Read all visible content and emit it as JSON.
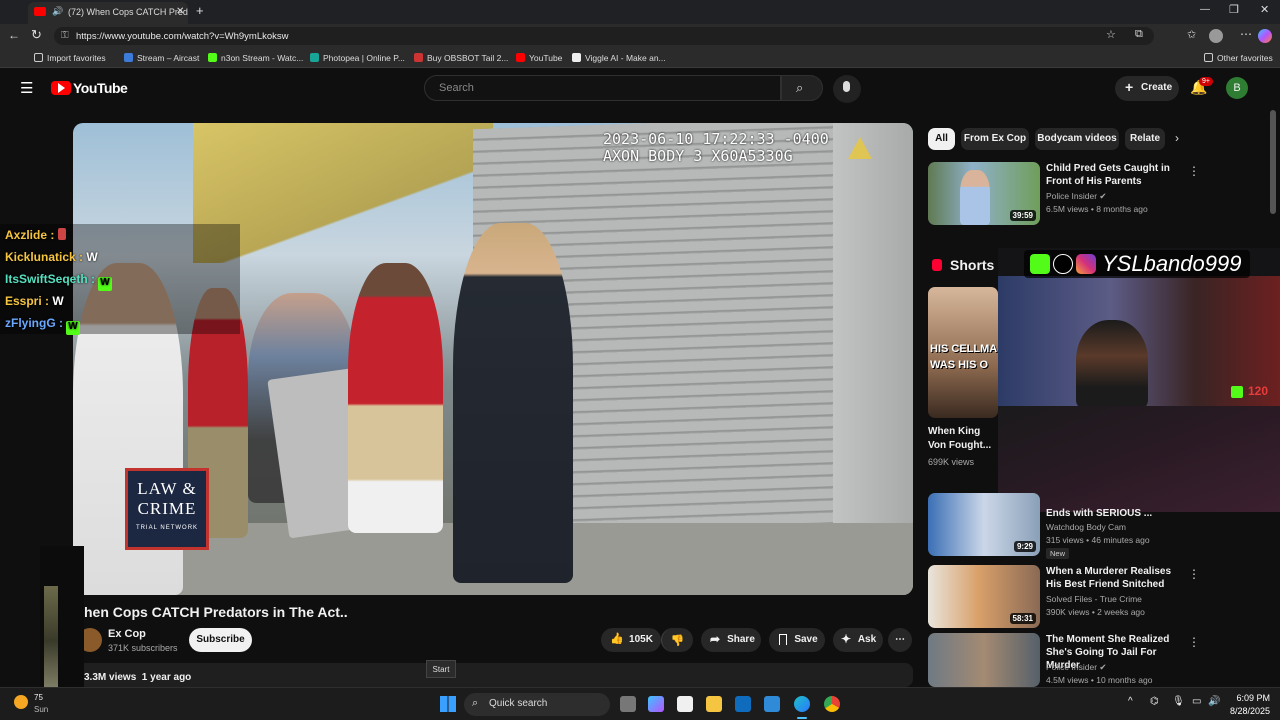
{
  "browser": {
    "tab_title": "(72) When Cops CATCH Predators...",
    "url": "https://www.youtube.com/watch?v=Wh9ymLkoksw",
    "bookmarks": [
      "Import favorites",
      "Stream – Aircast",
      "n3on Stream - Watc...",
      "Photopea | Online P...",
      "Buy OBSBOT Tail 2...",
      "YouTube",
      "Viggle AI - Make an..."
    ],
    "other_favorites": "Other favorites"
  },
  "youtube": {
    "logo": "YouTube",
    "search_placeholder": "Search",
    "create_label": "Create",
    "notif_count": "9+",
    "avatar_letter": "B"
  },
  "video": {
    "timestamp": "2023-06-10 17:22:33 -0400",
    "camera": "AXON BODY 3 X60A5330G",
    "watermark_line1": "LAW & CRIME",
    "watermark_line2": "TRIAL NETWORK",
    "title": "hen Cops CATCH Predators in The Act..",
    "channel": "Ex Cop",
    "subscribers": "371K subscribers",
    "subscribe_label": "Subscribe",
    "likes": "105K",
    "share_label": "Share",
    "save_label": "Save",
    "ask_label": "Ask",
    "views_line": "3.3M views  1 year ago",
    "start_tooltip": "Start"
  },
  "chat": [
    {
      "user": "Axzlide :",
      "msg": ""
    },
    {
      "user": "Kicklunatick :",
      "msg": "W"
    },
    {
      "user": "ItsSwiftSeqeth :",
      "msg": ""
    },
    {
      "user": "Esspri :",
      "msg": "W"
    },
    {
      "user": "zFlyingG :",
      "msg": ""
    }
  ],
  "chips": [
    "All",
    "From Ex Cop",
    "Bodycam videos",
    "Relate"
  ],
  "recommendations": [
    {
      "title": "Child Pred Gets Caught in Front of His Parents",
      "channel": "Police Insider",
      "meta": "6.5M views • 8 months ago",
      "duration": "39:59"
    },
    {
      "title": "Ends with SERIOUS ...",
      "channel": "Watchdog Body Cam",
      "meta": "315 views • 46 minutes ago",
      "duration": "9:29",
      "badge": "New"
    },
    {
      "title": "When a Murderer Realises His Best Friend Snitched",
      "channel": "Solved Files - True Crime",
      "meta": "390K views • 2 weeks ago",
      "duration": "58:31"
    },
    {
      "title": "The Moment She Realized She's Going To Jail For Murder",
      "channel": "Police Insider",
      "meta": "4.5M views • 10 months ago",
      "duration": ""
    }
  ],
  "shorts": {
    "label": "Shorts",
    "thumb_text": "HIS CELLMA WAS HIS O",
    "title": "When King Von Fought...",
    "views": "699K views"
  },
  "webcam": {
    "name": "YSLbando999",
    "kick_count": "120"
  },
  "taskbar": {
    "search_placeholder": "Quick search",
    "time": "6:09 PM",
    "date": "8/28/2025",
    "weather_temp": "75",
    "weather_label": "Sun"
  },
  "colors": {
    "yt_red": "#ff0000",
    "kick_green": "#53fc18",
    "bg": "#0f0f0f"
  }
}
